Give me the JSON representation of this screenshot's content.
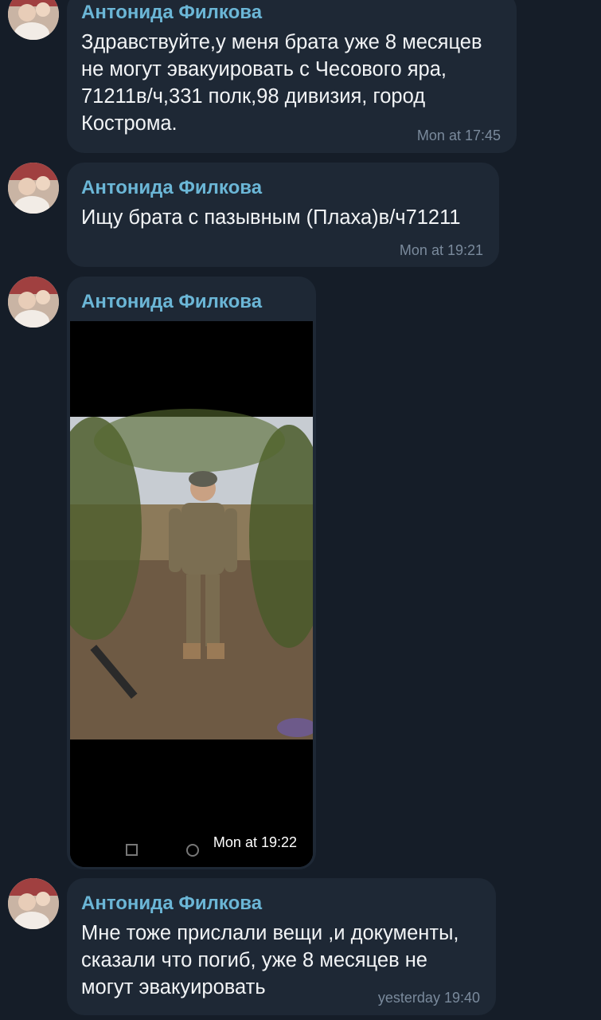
{
  "messages": [
    {
      "sender": "Антонида Филкова",
      "text": "Здравствуйте,у меня брата уже 8 месяцев\nне могут эвакуировать с Чесового яра,\n71211в/ч,331 полк,98 дивизия, город\nКострома.",
      "time": "Mon at 17:45"
    },
    {
      "sender": "Антонида Филкова",
      "text": "Ищу брата с пазывным (Плаха)в/ч71211",
      "time": "Mon at 19:21"
    },
    {
      "sender": "Антонида Филкова",
      "time": "Mon at 19:22"
    },
    {
      "sender": "Антонида Филкова",
      "text": "Мне тоже прислали вещи ,и документы,\nсказали что погиб, уже 8 месяцев не\nмогут эвакуировать",
      "time": "yesterday 19:40"
    }
  ],
  "colors": {
    "background": "#151d28",
    "bubble": "#1e2835",
    "sender": "#6bb6d6",
    "text": "#f2f4f6",
    "time": "#7a8a9c"
  }
}
